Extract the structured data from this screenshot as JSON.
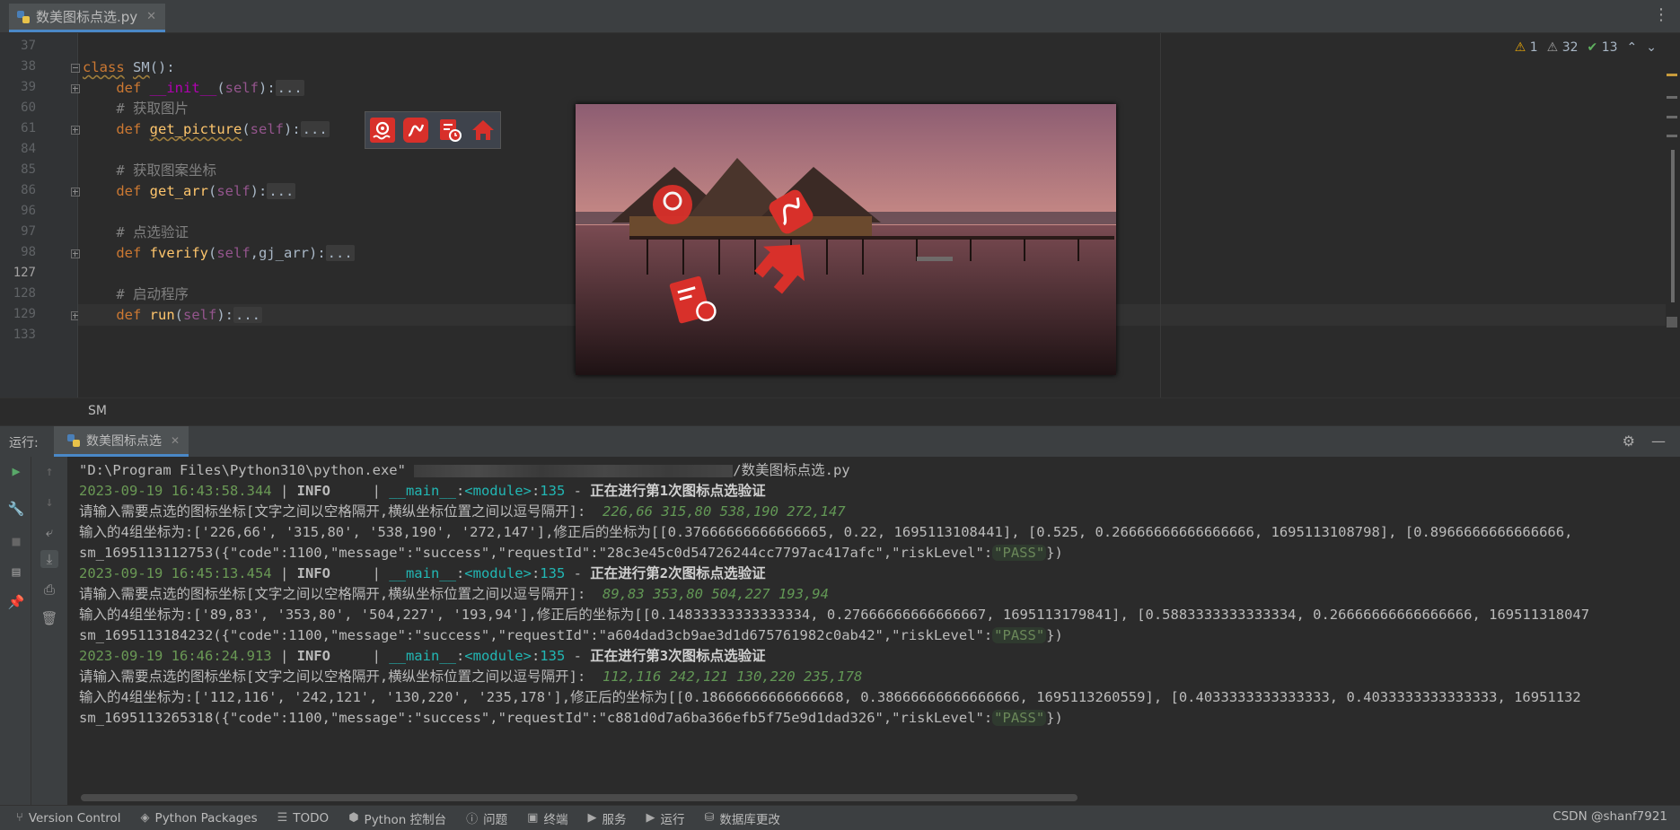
{
  "window": {
    "file_tab": "数美图标点选.py",
    "more_icon": "more-vertical-icon"
  },
  "editor": {
    "lines": [
      {
        "num": "37",
        "html": ""
      },
      {
        "num": "38",
        "html": "<span class=\"kw wavy\">class</span> <span class=\"wavy\">SM</span>():"
      },
      {
        "num": "39",
        "html": "    <span class=\"kw\">def</span> <span class=\"mg\">__init__</span>(<span class=\"sf\">self</span>):<span class=\"dots\">...</span>"
      },
      {
        "num": "60",
        "html": "    <span class=\"cm\"># 获取图片</span>"
      },
      {
        "num": "61",
        "html": "    <span class=\"kw\">def</span> <span class=\"fn wavy\">get_picture</span>(<span class=\"sf\">self</span>):<span class=\"dots\">...</span>"
      },
      {
        "num": "84",
        "html": ""
      },
      {
        "num": "85",
        "html": "    <span class=\"cm\"># 获取图案坐标</span>"
      },
      {
        "num": "86",
        "html": "    <span class=\"kw\">def</span> <span class=\"fn\">get_arr</span>(<span class=\"sf\">self</span>):<span class=\"dots\">...</span>"
      },
      {
        "num": "96",
        "html": ""
      },
      {
        "num": "97",
        "html": "    <span class=\"cm\"># 点选验证</span>"
      },
      {
        "num": "98",
        "html": "    <span class=\"kw\">def</span> <span class=\"fn\">fverify</span>(<span class=\"sf\">self</span>,gj_arr):<span class=\"dots\">...</span>"
      },
      {
        "num": "127",
        "html": ""
      },
      {
        "num": "128",
        "html": "    <span class=\"cm\"># 启动程序</span>"
      },
      {
        "num": "129",
        "html": "    <span class=\"kw\">def</span> <span class=\"fn\">run</span>(<span class=\"sf\">self</span>):<span class=\"dots\">...</span>"
      },
      {
        "num": "133",
        "html": ""
      }
    ],
    "inspections": {
      "warnings": "1",
      "weak_warnings": "32",
      "typos": "13"
    },
    "breadcrumb": "SM"
  },
  "run_panel": {
    "label": "运行:",
    "tab": "数美图标点选",
    "console": [
      {
        "html": "\"D:\\Program Files\\Python310\\python.exe\" <span class=\"blur\"></span>/数美图标点选.py"
      },
      {
        "html": "<span class=\"ts\">2023-09-19 16:43:58.344</span> | <span class=\"lv\">INFO    </span> | <span class=\"mod\">__main__</span>:<span class=\"mod\">&lt;module&gt;</span>:<span class=\"mod\">135</span> - <span class=\"hl\">正在进行第1次图标点选验证</span>"
      },
      {
        "html": "请输入需要点选的图标坐标[文字之间以空格隔开,横纵坐标位置之间以逗号隔开]:  <span class=\"inp\">226,66 315,80 538,190 272,147</span>"
      },
      {
        "html": "输入的4组坐标为:['226,66', '315,80', '538,190', '272,147'],修正后的坐标为[[0.37666666666666665, 0.22, 1695113108441], [0.525, 0.26666666666666666, 1695113108798], [0.8966666666666666,"
      },
      {
        "html": "sm_1695113112753({\"code\":1100,\"message\":\"success\",\"requestId\":\"28c3e45c0d54726244cc7797ac417afc\",\"riskLevel\":<span class=\"pass\">\"PASS\"</span>})"
      },
      {
        "html": "<span class=\"ts\">2023-09-19 16:45:13.454</span> | <span class=\"lv\">INFO    </span> | <span class=\"mod\">__main__</span>:<span class=\"mod\">&lt;module&gt;</span>:<span class=\"mod\">135</span> - <span class=\"hl\">正在进行第2次图标点选验证</span>"
      },
      {
        "html": "请输入需要点选的图标坐标[文字之间以空格隔开,横纵坐标位置之间以逗号隔开]:  <span class=\"inp\">89,83 353,80 504,227 193,94</span>"
      },
      {
        "html": "输入的4组坐标为:['89,83', '353,80', '504,227', '193,94'],修正后的坐标为[[0.14833333333333334, 0.27666666666666667, 1695113179841], [0.5883333333333334, 0.26666666666666666, 169511318047"
      },
      {
        "html": "sm_1695113184232({\"code\":1100,\"message\":\"success\",\"requestId\":\"a604dad3cb9ae3d1d675761982c0ab42\",\"riskLevel\":<span class=\"pass\">\"PASS\"</span>})"
      },
      {
        "html": "<span class=\"ts\">2023-09-19 16:46:24.913</span> | <span class=\"lv\">INFO    </span> | <span class=\"mod\">__main__</span>:<span class=\"mod\">&lt;module&gt;</span>:<span class=\"mod\">135</span> - <span class=\"hl\">正在进行第3次图标点选验证</span>"
      },
      {
        "html": "请输入需要点选的图标坐标[文字之间以空格隔开,横纵坐标位置之间以逗号隔开]:  <span class=\"inp\">112,116 242,121 130,220 235,178</span>"
      },
      {
        "html": "输入的4组坐标为:['112,116', '242,121', '130,220', '235,178'],修正后的坐标为[[0.18666666666666668, 0.38666666666666666, 1695113260559], [0.4033333333333333, 0.4033333333333333, 16951132"
      },
      {
        "html": "sm_1695113265318({\"code\":1100,\"message\":\"success\",\"requestId\":\"c881d0d7a6ba366efb5f75e9d1dad326\",\"riskLevel\":<span class=\"pass\">\"PASS\"</span>})"
      }
    ]
  },
  "statusbar": {
    "items": [
      {
        "icon": "version-control-icon",
        "glyph": "⑂",
        "label": "Version Control"
      },
      {
        "icon": "python-packages-icon",
        "glyph": "◈",
        "label": "Python Packages"
      },
      {
        "icon": "todo-icon",
        "glyph": "☰",
        "label": "TODO"
      },
      {
        "icon": "python-console-icon",
        "glyph": "⬢",
        "label": "Python 控制台"
      },
      {
        "icon": "problems-icon",
        "glyph": "ⓘ",
        "label": "问题"
      },
      {
        "icon": "terminal-icon",
        "glyph": "▣",
        "label": "终端"
      },
      {
        "icon": "services-icon",
        "glyph": "▶",
        "label": "服务"
      },
      {
        "icon": "run-icon",
        "glyph": "▶",
        "label": "运行"
      },
      {
        "icon": "database-changes-icon",
        "glyph": "⛁",
        "label": "数据库更改"
      }
    ],
    "watermark": "CSDN @shanf7921"
  },
  "colors": {
    "accent": "#4a88c7",
    "icon_red": "#d8302a"
  }
}
